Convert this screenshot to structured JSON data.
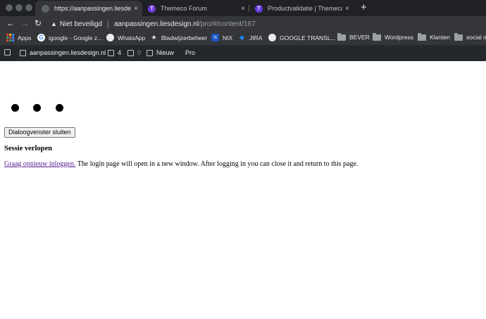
{
  "browser": {
    "tabs": [
      {
        "title": "https://aanpassingen.liesdesign.",
        "active": true,
        "favicon": "globe-icon"
      },
      {
        "title": "Themeco Forum",
        "active": false,
        "favicon": "themeco-icon"
      },
      {
        "title": "Productvalidatie | Themeco Do",
        "active": false,
        "favicon": "themeco-icon"
      }
    ],
    "tab_close_glyph": "×",
    "new_tab_glyph": "+",
    "themeco_letter": "T",
    "nav": {
      "back": "←",
      "forward": "→",
      "reload": "↻"
    },
    "omnibox": {
      "warning_glyph": "▲",
      "security_label": "Niet beveiligd",
      "url_host": "aanpassingen.liesdesign.nl",
      "url_path": "/pro/#/content/167"
    },
    "bookmarks": [
      {
        "label": "Apps",
        "icon": "apps-grid-icon"
      },
      {
        "label": "igoogle - Google z...",
        "icon": "google-icon"
      },
      {
        "label": "WhatsApp",
        "icon": "globe-icon"
      },
      {
        "label": "Bladwijzerbeheer",
        "icon": "star-icon"
      },
      {
        "label": "NIX",
        "icon": "nix-icon"
      },
      {
        "label": "JIRA",
        "icon": "jira-icon"
      },
      {
        "label": "GOOGLE TRANSL...",
        "icon": "globe-icon"
      },
      {
        "label": "BEVER",
        "icon": "folder-icon"
      },
      {
        "label": "Wordpress",
        "icon": "folder-icon"
      },
      {
        "label": "Klanten",
        "icon": "folder-icon"
      },
      {
        "label": "social m",
        "icon": "folder-icon"
      }
    ]
  },
  "adminbar": {
    "site_name": "aanpassingen.liesdesign.nl",
    "updates_count": "4",
    "comments_count": "0",
    "new_label": "Nieuw",
    "pro_label": "Pro"
  },
  "page": {
    "close_button_label": "Dialoogvenster sluiten",
    "heading": "Sessie verlopen",
    "login_link": "Graag opnieuw inloggen.",
    "message": " The login page will open in a new window. After logging in you can close it and return to this page."
  },
  "colors": {
    "tab_strip": "#202124",
    "toolbar": "#35363a",
    "admin_bar": "#23282d",
    "visited_link": "#551a8b",
    "themeco_purple": "#6a3ce0"
  }
}
